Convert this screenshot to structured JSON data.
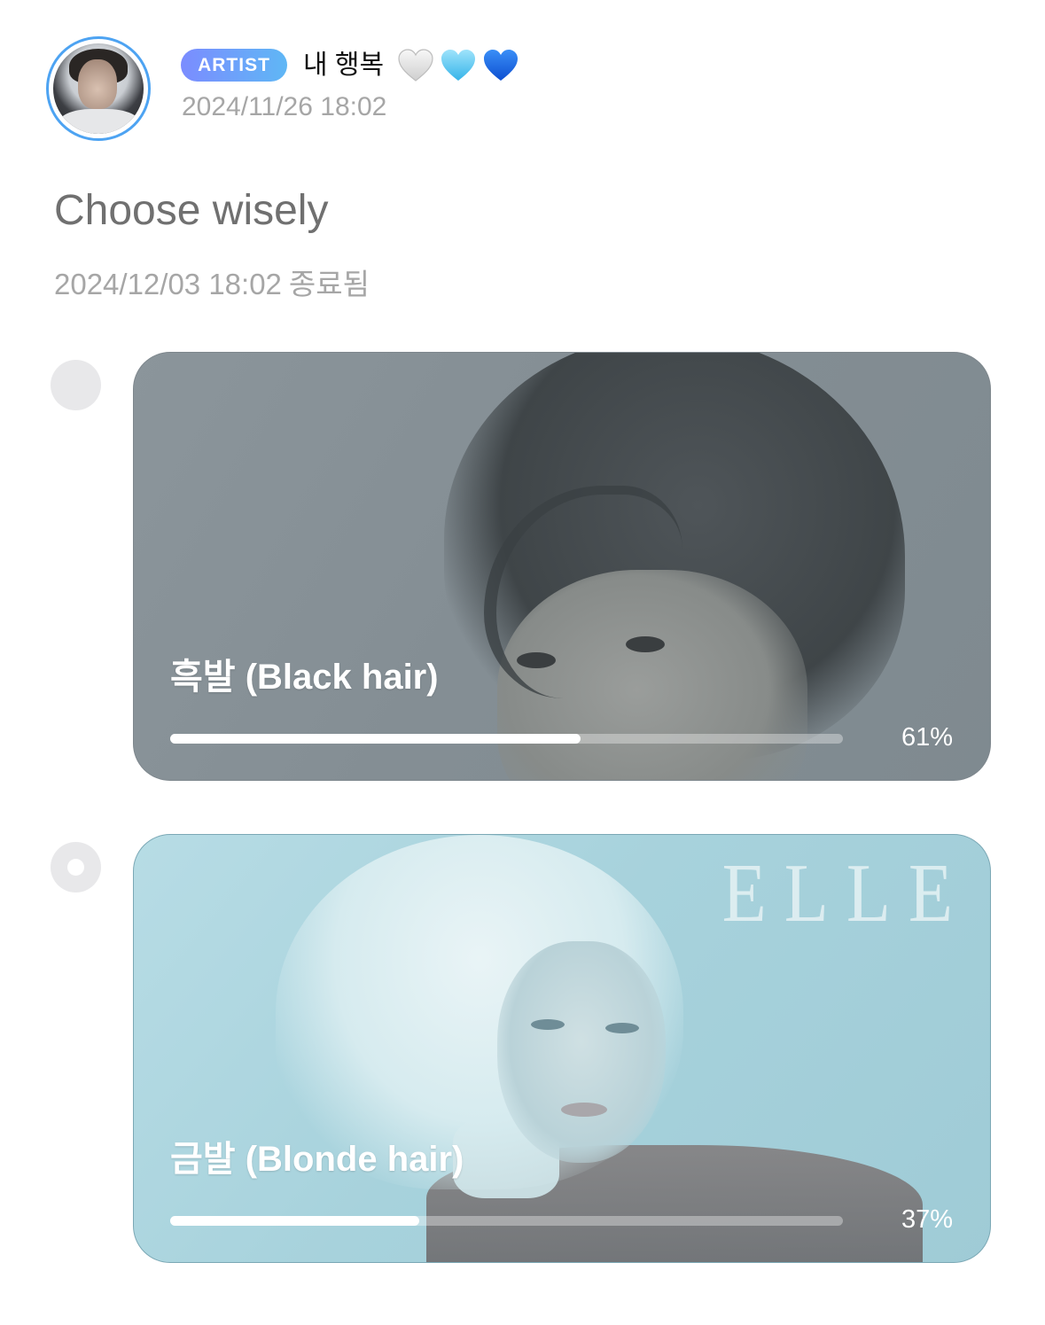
{
  "post": {
    "badge": "ARTIST",
    "author": "내 행복",
    "hearts": [
      "white-heart-icon",
      "light-blue-heart-icon",
      "blue-heart-icon"
    ],
    "date": "2024/11/26 18:02"
  },
  "poll": {
    "title": "Choose wisely",
    "end_date": "2024/12/03 18:02",
    "status": "종료됨",
    "options": [
      {
        "label": "흑발 (Black hair)",
        "percent": "61%",
        "fill": 0.61,
        "selected": false
      },
      {
        "label": "금발 (Blonde hair)",
        "percent": "37%",
        "fill": 0.37,
        "selected": true,
        "watermark": "ELLE"
      }
    ]
  },
  "colors": {
    "badge_gradient_start": "#7b8cff",
    "badge_gradient_end": "#5fb7f5",
    "avatar_ring": "#4da3f2",
    "muted_text": "#a6a6a6",
    "title_text": "#707070"
  }
}
